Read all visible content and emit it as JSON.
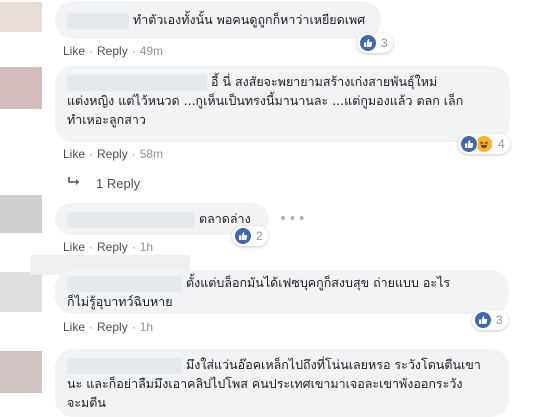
{
  "actions": {
    "like": "Like",
    "reply": "Reply",
    "separator": "·"
  },
  "comments": [
    {
      "lines": [
        "ทำตัวเองทั้งนั้น พอคนดูถูกก็หาว่าเหยียดเพศ"
      ],
      "time": "49m",
      "reactions": {
        "icons": [
          "like-icon"
        ],
        "count": "3"
      },
      "avatar_color": "#e8dcd9"
    },
    {
      "lines": [
        "อี้    นี่ สงสัยจะพยายามสร้างเก่งสายพันธุ์ใหม่",
        "แต่งหญิง แต่ไว้หนวด ...กูเห็นเป็นทรงนี้มานานละ ...แต่กูมองแล้ว ตลก เล็ก",
        "ทำเหอะลูกสาว"
      ],
      "time": "58m",
      "reactions": {
        "icons": [
          "like-icon",
          "haha-icon"
        ],
        "count": "4"
      },
      "avatar_color": "#d4bcbc"
    },
    {
      "lines": [
        "ตลาดล่าง"
      ],
      "time": "1h",
      "reactions": {
        "icons": [
          "like-icon"
        ],
        "count": "2"
      },
      "avatar_color": "#cfcfcf"
    },
    {
      "lines": [
        "ตั้งแต่บล็อกมันได้เฟซบุคกูก็สงบสุข ถ่ายแบบ      อะไร",
        "ก็ไม่รู้อุบาทว์ฉิบหาย"
      ],
      "time": "1h",
      "reactions": {
        "icons": [
          "like-icon"
        ],
        "count": "3"
      },
      "avatar_color": "#dedede"
    },
    {
      "lines": [
        "มึงใส่แว่นอ๊อคเหล็กไปถึงที่โน่นเลยหรอ ระวังโดนตีนเขา",
        "นะ และก็อย่าลืมมึงเอาคลิปไปโพส คนประเทศเขามาเจอละเขาพังออกระวัง",
        "จะมตีน"
      ],
      "time": "",
      "reactions": {
        "icons": [],
        "count": ""
      },
      "avatar_color": "#d2c6c4"
    }
  ],
  "replies_link": {
    "icon": "reply-arrow-icon",
    "label": "1 Reply"
  },
  "more_options_icon": "more-options-icon",
  "colors": {
    "bubble_bg": "#f2f3f5",
    "like_blue": "#4267b2",
    "action_text": "#4b4f56",
    "meta_text": "#90949c",
    "haha_yellow": "#f7b125"
  }
}
